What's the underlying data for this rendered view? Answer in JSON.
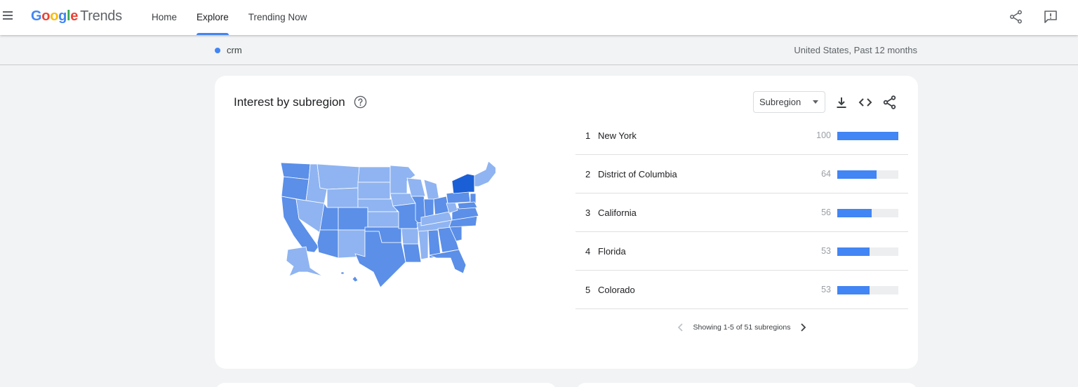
{
  "header": {
    "logo_google": "Google",
    "logo_trends": "Trends",
    "nav": [
      {
        "label": "Home",
        "active": false
      },
      {
        "label": "Explore",
        "active": true
      },
      {
        "label": "Trending Now",
        "active": false
      }
    ],
    "icons": [
      "menu-icon",
      "share-icon",
      "feedback-icon"
    ]
  },
  "subheader": {
    "term": "crm",
    "term_color": "#4285f4",
    "scope": "United States, Past 12 months"
  },
  "card": {
    "title": "Interest by subregion",
    "help_icon": "help-circle-icon",
    "dropdown_value": "Subregion",
    "tool_icons": [
      "download-icon",
      "embed-icon",
      "share-icon"
    ],
    "map_icon": "us-choropleth-map",
    "rows": [
      {
        "rank": "1",
        "name": "New York",
        "value": 100
      },
      {
        "rank": "2",
        "name": "District of Columbia",
        "value": 64
      },
      {
        "rank": "3",
        "name": "California",
        "value": 56
      },
      {
        "rank": "4",
        "name": "Florida",
        "value": 53
      },
      {
        "rank": "5",
        "name": "Colorado",
        "value": 53
      }
    ],
    "pager_text": "Showing 1-5 of 51 subregions"
  },
  "colors": {
    "accent": "#4285f4",
    "map_high": "#1a5fd6",
    "map_mid": "#5b8fe8",
    "map_low": "#8fb4f1"
  }
}
